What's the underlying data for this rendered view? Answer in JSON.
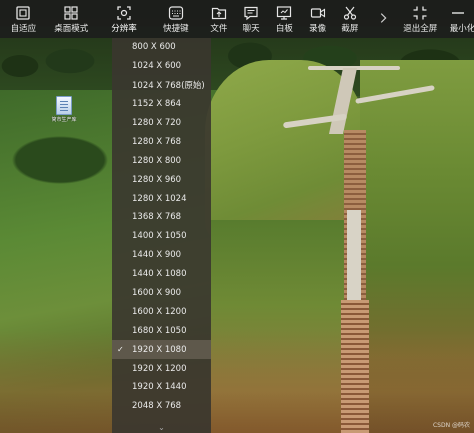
{
  "toolbar": {
    "items": [
      {
        "id": "fit",
        "label": "自适应",
        "icon": "fit-screen-icon"
      },
      {
        "id": "desktop-mode",
        "label": "桌面模式",
        "icon": "grid-icon"
      },
      {
        "id": "resolution",
        "label": "分辨率",
        "icon": "resolution-icon"
      },
      {
        "id": "shortcut",
        "label": "快捷键",
        "icon": "keyboard-icon"
      },
      {
        "id": "file",
        "label": "文件",
        "icon": "folder-icon"
      },
      {
        "id": "chat",
        "label": "聊天",
        "icon": "chat-icon"
      },
      {
        "id": "whiteboard",
        "label": "白板",
        "icon": "whiteboard-icon"
      },
      {
        "id": "record",
        "label": "录像",
        "icon": "camera-icon"
      },
      {
        "id": "screenshot",
        "label": "截屏",
        "icon": "scissors-icon"
      },
      {
        "id": "exit-fullscreen",
        "label": "退出全屏",
        "icon": "exit-fullscreen-icon"
      },
      {
        "id": "minimize",
        "label": "最小化",
        "icon": "minimize-icon"
      }
    ],
    "more_icon": "chevron-right-icon"
  },
  "resolution_menu": {
    "options": [
      "800 X 600",
      "1024 X 600",
      "1024 X 768(原始)",
      "1152 X 864",
      "1280 X 720",
      "1280 X 768",
      "1280 X 800",
      "1280 X 960",
      "1280 X 1024",
      "1368 X 768",
      "1400 X 1050",
      "1440 X 900",
      "1440 X 1080",
      "1600 X 900",
      "1600 X 1200",
      "1680 X 1050",
      "1920 X 1080",
      "1920 X 1200",
      "1920 X 1440",
      "2048 X 768"
    ],
    "selected": "1920 X 1080",
    "check_glyph": "✓",
    "scroll_glyph": "⌄"
  },
  "desktop": {
    "icon_label": "简市生产库"
  },
  "watermark": "CSDN @码农"
}
